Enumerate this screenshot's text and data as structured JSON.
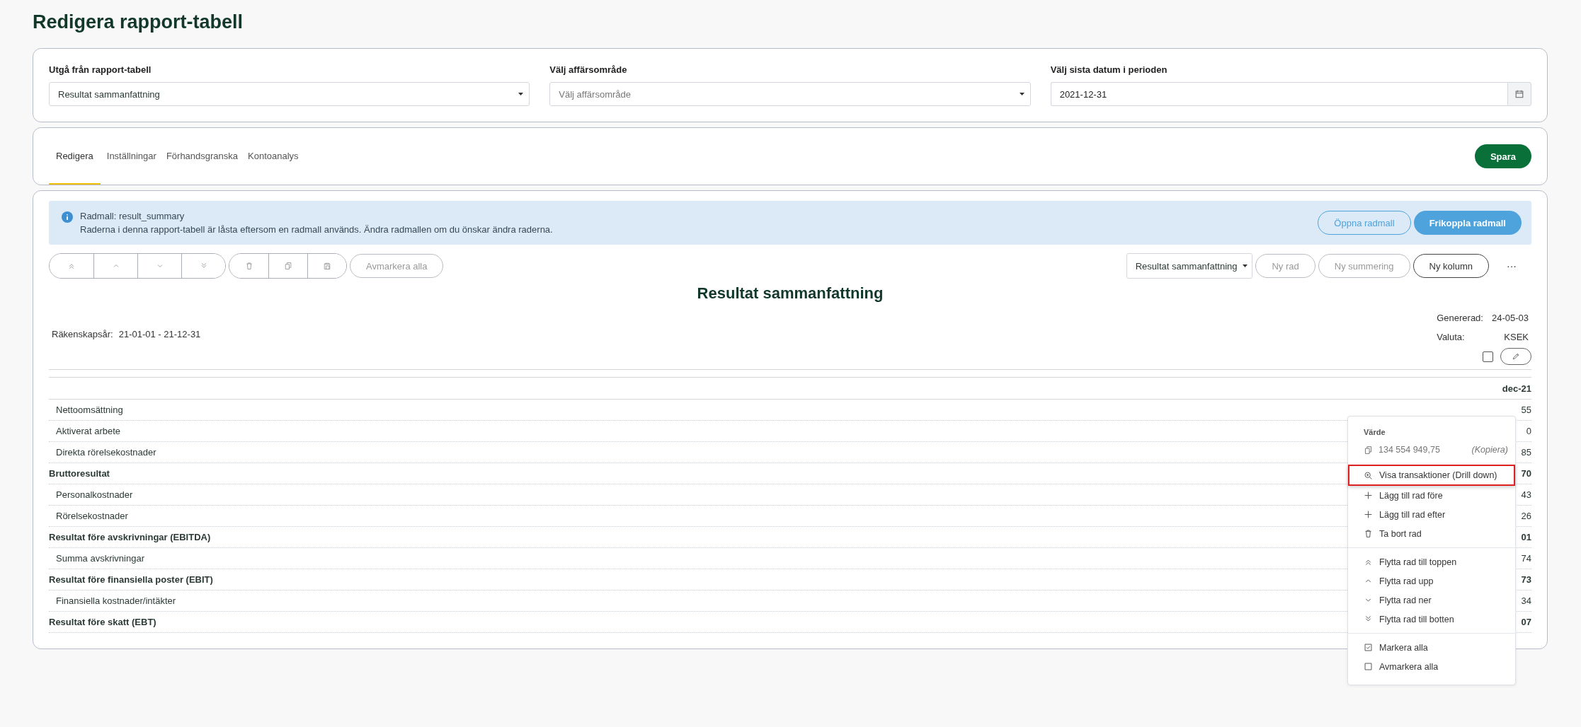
{
  "page_title": "Redigera rapport-tabell",
  "filters": [
    {
      "kind": "select",
      "label": "Utgå från rapport-tabell",
      "value": "Resultat sammanfattning"
    },
    {
      "kind": "select",
      "label": "Välj affärsområde",
      "placeholder": "Välj affärsområde"
    },
    {
      "kind": "date",
      "label": "Välj sista datum i perioden",
      "value": "2021-12-31"
    }
  ],
  "tabs": [
    {
      "label": "Redigera",
      "selected": true
    },
    {
      "label": "Inställningar",
      "selected": false
    },
    {
      "label": "Förhandsgranska",
      "selected": false
    },
    {
      "label": "Kontoanalys",
      "selected": false
    }
  ],
  "save_button": "Spara",
  "banner": {
    "title": "Radmall: result_summary",
    "text": "Raderna i denna rapport-tabell är låsta eftersom en radmall används. Ändra radmallen om du önskar ändra raderna.",
    "open_button": "Öppna radmall",
    "detach_button": "Frikoppla radmall"
  },
  "toolbar": {
    "move_buttons": [
      {
        "kind": "top",
        "disabled": true
      },
      {
        "kind": "up",
        "disabled": true
      },
      {
        "kind": "down",
        "disabled": true
      },
      {
        "kind": "bottom",
        "disabled": true
      }
    ],
    "edit_buttons": [
      {
        "kind": "delete",
        "disabled": true
      },
      {
        "kind": "copy",
        "disabled": true
      },
      {
        "kind": "paste",
        "disabled": true
      }
    ],
    "deselect_button": {
      "label": "Avmarkera alla",
      "disabled": true
    },
    "template_select": "Resultat sammanfattning",
    "action_buttons": [
      {
        "label": "Ny rad",
        "disabled": true
      },
      {
        "label": "Ny summering",
        "disabled": true
      },
      {
        "label": "Ny kolumn",
        "disabled": false
      }
    ],
    "more_button": "···"
  },
  "report": {
    "title": "Resultat sammanfattning",
    "meta_left": {
      "label": "Räkenskapsår:",
      "value": "21-01-01 - 21-12-31"
    },
    "meta_right": [
      {
        "label": "Genererad:",
        "value": "24-05-03"
      },
      {
        "label": "Valuta:",
        "value": "KSEK"
      }
    ],
    "select_all_checked": false,
    "column": "dec-21",
    "rows": [
      {
        "kind": "line",
        "label": "Nettoomsättning",
        "value": "55"
      },
      {
        "kind": "line",
        "label": "Aktiverat arbete",
        "value": "0"
      },
      {
        "kind": "line",
        "label": "Direkta rörelsekostnader",
        "value": "85"
      },
      {
        "kind": "sum",
        "label": "Bruttoresultat",
        "value": "70"
      },
      {
        "kind": "line",
        "label": "Personalkostnader",
        "value": "43"
      },
      {
        "kind": "line",
        "label": "Rörelsekostnader",
        "value": "26"
      },
      {
        "kind": "sum",
        "label": "Resultat före avskrivningar (EBITDA)",
        "value": "01"
      },
      {
        "kind": "line",
        "label": "Summa avskrivningar",
        "value": "74"
      },
      {
        "kind": "sum",
        "label": "Resultat före finansiella poster (EBIT)",
        "value": "73"
      },
      {
        "kind": "line",
        "label": "Finansiella kostnader/intäkter",
        "value": "34"
      },
      {
        "kind": "sum",
        "label": "Resultat före skatt (EBT)",
        "value": "07"
      }
    ]
  },
  "context_menu": {
    "heading": "Värde",
    "value": "134 554 949,75",
    "copy": "(Kopiera)",
    "groups": [
      [
        {
          "kind": "drill",
          "label": "Visa transaktioner (Drill down)",
          "highlighted": true
        },
        {
          "kind": "add",
          "label": "Lägg till rad före",
          "highlighted": false
        },
        {
          "kind": "add",
          "label": "Lägg till rad efter",
          "highlighted": false
        },
        {
          "kind": "delete",
          "label": "Ta bort rad",
          "highlighted": false
        }
      ],
      [
        {
          "kind": "top",
          "label": "Flytta rad till toppen",
          "highlighted": false
        },
        {
          "kind": "up",
          "label": "Flytta rad upp",
          "highlighted": false
        },
        {
          "kind": "down",
          "label": "Flytta rad ner",
          "highlighted": false
        },
        {
          "kind": "bottom",
          "label": "Flytta rad till botten",
          "highlighted": false
        }
      ],
      [
        {
          "kind": "check",
          "label": "Markera alla",
          "highlighted": false
        },
        {
          "kind": "uncheck",
          "label": "Avmarkera alla",
          "highlighted": false
        }
      ]
    ]
  }
}
